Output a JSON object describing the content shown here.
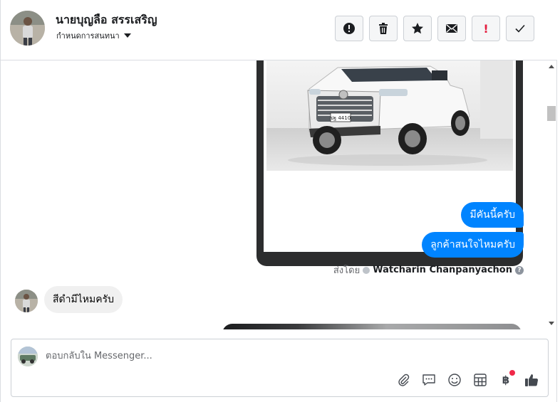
{
  "header": {
    "contact_name": "นายบุญลือ สรรเสริญ",
    "assign_label": "กำหนดการสนทนา",
    "toolbar": [
      {
        "name": "alert-button",
        "icon": "alert-circle-icon"
      },
      {
        "name": "delete-button",
        "icon": "trash-icon"
      },
      {
        "name": "star-button",
        "icon": "star-icon"
      },
      {
        "name": "mark-unread-button",
        "icon": "envelope-icon"
      },
      {
        "name": "spam-button",
        "icon": "exclamation-icon",
        "label": "!"
      },
      {
        "name": "done-button",
        "icon": "checkmark-icon"
      }
    ]
  },
  "conversation": {
    "messages_out": [
      {
        "text": "มีคันนี้ครับ"
      },
      {
        "text": "ลูกค้าสนใจไหมครับ"
      }
    ],
    "sent_by": {
      "prefix": "ส่งโดย",
      "name": "Watcharin Chanpanyachon",
      "help": "?"
    },
    "message_in": {
      "text": "สีดำมีไหมครับ"
    },
    "photo_plate": "ปฐ 4410"
  },
  "composer": {
    "placeholder": "ตอบกลับใน Messenger...",
    "baht_symbol": "฿",
    "icons": [
      "attachment-icon",
      "saved-reply-icon",
      "emoji-icon",
      "catalog-icon",
      "payment-icon",
      "thumbs-up-icon"
    ]
  },
  "colors": {
    "accent": "#0084ff",
    "incoming_bubble": "#f0f0f0",
    "notification": "#f02849"
  }
}
